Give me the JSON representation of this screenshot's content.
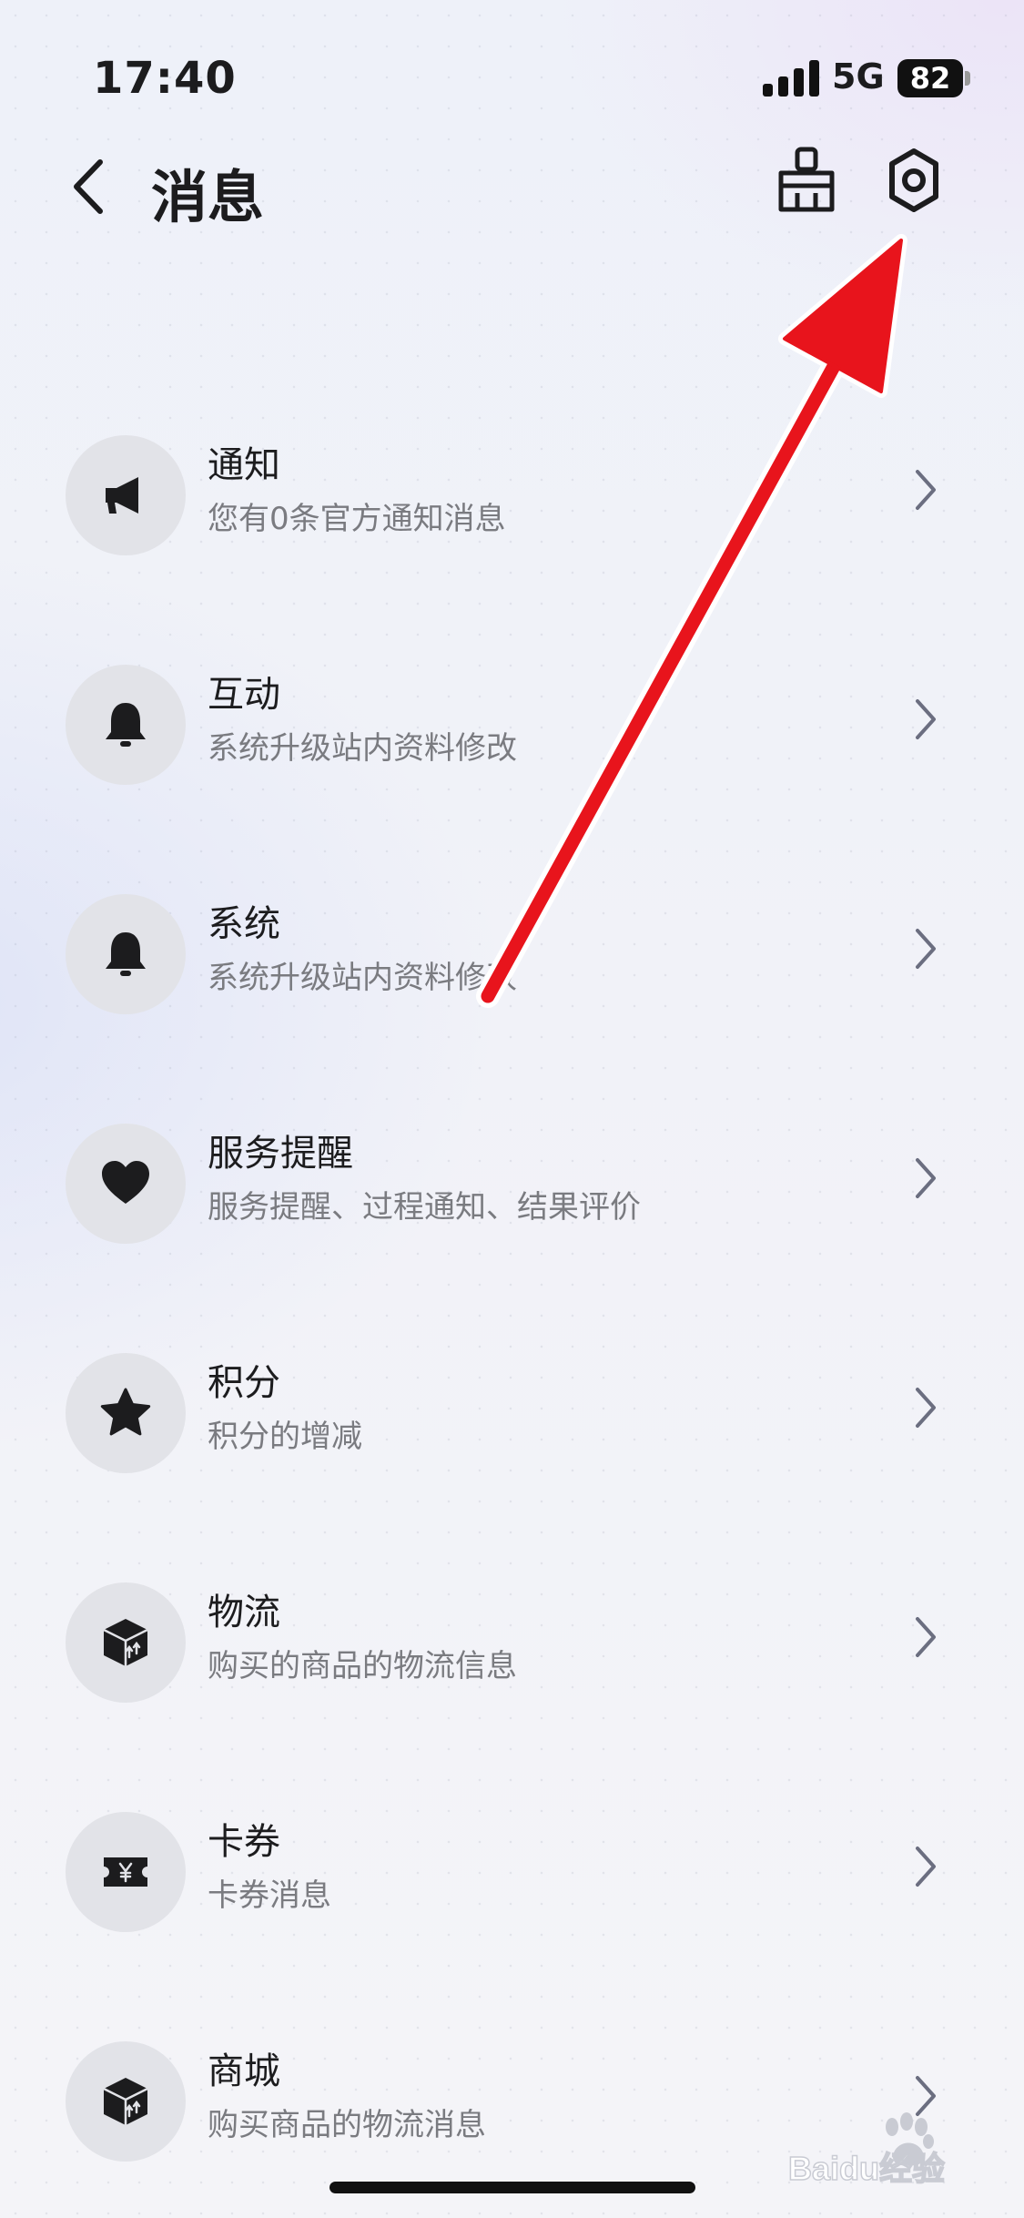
{
  "status_bar": {
    "time": "17:40",
    "network": "5G",
    "battery": "82"
  },
  "header": {
    "title": "消息",
    "back_icon": "chevron-left-icon",
    "clean_icon": "broom-icon",
    "settings_icon": "gear-icon"
  },
  "items": [
    {
      "title": "通知",
      "subtitle": "您有0条官方通知消息",
      "icon": "megaphone-icon"
    },
    {
      "title": "互动",
      "subtitle": "系统升级站内资料修改",
      "icon": "bell-icon"
    },
    {
      "title": "系统",
      "subtitle": "系统升级站内资料修改",
      "icon": "bell-icon"
    },
    {
      "title": "服务提醒",
      "subtitle": "服务提醒、过程通知、结果评价",
      "icon": "heart-icon"
    },
    {
      "title": "积分",
      "subtitle": "积分的增减",
      "icon": "star-icon"
    },
    {
      "title": "物流",
      "subtitle": "购买的商品的物流信息",
      "icon": "package-icon"
    },
    {
      "title": "卡券",
      "subtitle": "卡券消息",
      "icon": "coupon-icon"
    },
    {
      "title": "商城",
      "subtitle": "购买商品的物流消息",
      "icon": "package-icon"
    }
  ],
  "annotation": {
    "color": "#e8141c"
  },
  "watermark": {
    "text": "Baidu经验"
  }
}
